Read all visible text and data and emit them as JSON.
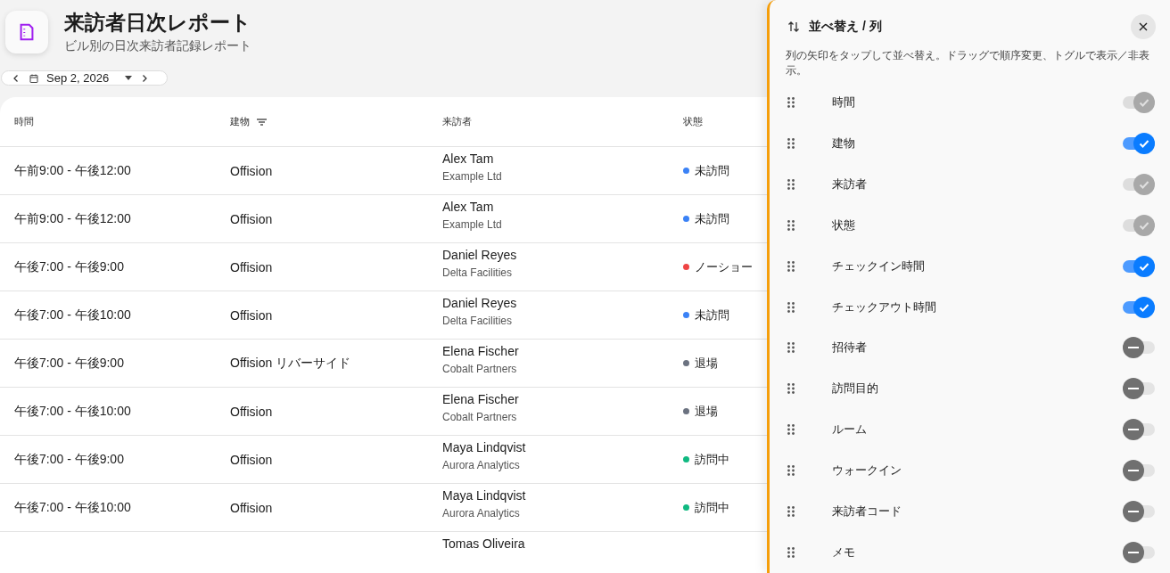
{
  "header": {
    "title": "来訪者日次レポート",
    "subtitle": "ビル別の日次来訪者記録レポート"
  },
  "date_picker": {
    "value": "Sep 2, 2026"
  },
  "table": {
    "columns": [
      {
        "label": "時間",
        "filter": false
      },
      {
        "label": "建物",
        "filter": true
      },
      {
        "label": "来訪者",
        "filter": false
      },
      {
        "label": "状態",
        "filter": false
      }
    ],
    "rows": [
      {
        "time": "午前9:00 - 午後12:00",
        "building": "Offision",
        "visitor": "Alex Tam",
        "company": "Example Ltd",
        "status": "未訪問",
        "color": "#3b82f6"
      },
      {
        "time": "午前9:00 - 午後12:00",
        "building": "Offision",
        "visitor": "Alex Tam",
        "company": "Example Ltd",
        "status": "未訪問",
        "color": "#3b82f6"
      },
      {
        "time": "午後7:00 - 午後9:00",
        "building": "Offision",
        "visitor": "Daniel Reyes",
        "company": "Delta Facilities",
        "status": "ノーショー",
        "color": "#ef4444"
      },
      {
        "time": "午後7:00 - 午後10:00",
        "building": "Offision",
        "visitor": "Daniel Reyes",
        "company": "Delta Facilities",
        "status": "未訪問",
        "color": "#3b82f6"
      },
      {
        "time": "午後7:00 - 午後9:00",
        "building": "Offision リバーサイド",
        "visitor": "Elena Fischer",
        "company": "Cobalt Partners",
        "status": "退場",
        "color": "#6b7280"
      },
      {
        "time": "午後7:00 - 午後10:00",
        "building": "Offision",
        "visitor": "Elena Fischer",
        "company": "Cobalt Partners",
        "status": "退場",
        "color": "#6b7280"
      },
      {
        "time": "午後7:00 - 午後9:00",
        "building": "Offision",
        "visitor": "Maya Lindqvist",
        "company": "Aurora Analytics",
        "status": "訪問中",
        "color": "#10b981"
      },
      {
        "time": "午後7:00 - 午後10:00",
        "building": "Offision",
        "visitor": "Maya Lindqvist",
        "company": "Aurora Analytics",
        "status": "訪問中",
        "color": "#10b981"
      },
      {
        "visitor": "Tomas Oliveira"
      }
    ]
  },
  "panel": {
    "title": "並べ替え / 列",
    "description": "列の矢印をタップして並べ替え。ドラッグで順序変更、トグルで表示／非表示。",
    "columns": [
      {
        "label": "時間",
        "on": true,
        "disabled": true
      },
      {
        "label": "建物",
        "on": true,
        "disabled": false
      },
      {
        "label": "来訪者",
        "on": true,
        "disabled": true
      },
      {
        "label": "状態",
        "on": true,
        "disabled": true
      },
      {
        "label": "チェックイン時間",
        "on": true,
        "disabled": false
      },
      {
        "label": "チェックアウト時間",
        "on": true,
        "disabled": false
      },
      {
        "label": "招待者",
        "on": false,
        "disabled": false
      },
      {
        "label": "訪問目的",
        "on": false,
        "disabled": false
      },
      {
        "label": "ルーム",
        "on": false,
        "disabled": false
      },
      {
        "label": "ウォークイン",
        "on": false,
        "disabled": false
      },
      {
        "label": "来訪者コード",
        "on": false,
        "disabled": false
      },
      {
        "label": "メモ",
        "on": false,
        "disabled": false
      }
    ]
  }
}
